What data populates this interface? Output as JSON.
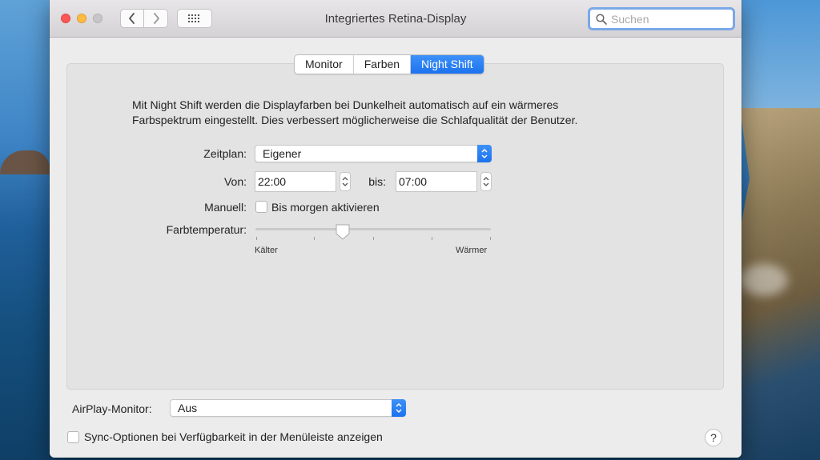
{
  "window": {
    "title": "Integriertes Retina-Display"
  },
  "search": {
    "placeholder": "Suchen"
  },
  "tabs": [
    {
      "label": "Monitor"
    },
    {
      "label": "Farben"
    },
    {
      "label": "Night Shift",
      "active": true
    }
  ],
  "night_shift": {
    "description_line1": "Mit Night Shift werden die Displayfarben bei Dunkelheit automatisch auf ein wärmeres",
    "description_line2": "Farbspektrum eingestellt. Dies verbessert möglicherweise die Schlafqualität der Benutzer.",
    "schedule_label": "Zeitplan:",
    "schedule_value": "Eigener",
    "from_label": "Von:",
    "from_value": "22:00",
    "to_label": "bis:",
    "to_value": "07:00",
    "manual_label": "Manuell:",
    "manual_checkbox_label": "Bis morgen aktivieren",
    "manual_checked": false,
    "temperature_label": "Farbtemperatur:",
    "temperature_min_label": "Kälter",
    "temperature_max_label": "Wärmer",
    "temperature_level": 0.37
  },
  "footer": {
    "airplay_label": "AirPlay-Monitor:",
    "airplay_value": "Aus",
    "sync_option_label": "Sync-Optionen bei Verfügbarkeit in der Menüleiste anzeigen",
    "sync_checked": false,
    "help_label": "?"
  },
  "colors": {
    "accent": "#1d72ef",
    "close": "#fc5753",
    "minimize": "#fdbc40"
  }
}
